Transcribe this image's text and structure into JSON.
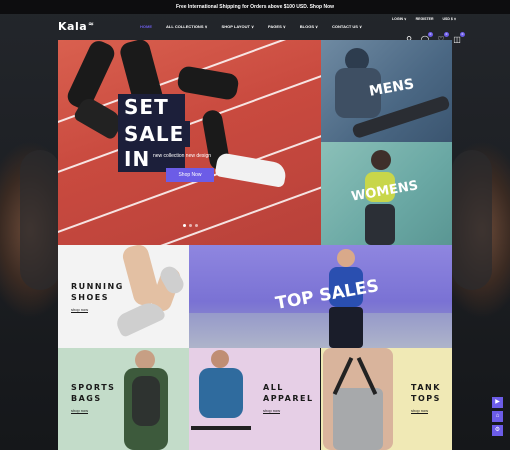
{
  "announcement": "Free International Shipping for Orders above $100 USD. Shop Now",
  "header": {
    "logo": "Kala",
    "nav": [
      "HOME",
      "ALL COLLECTIONS ∨",
      "SHOP LAYOUT ∨",
      "PAGES ∨",
      "BLOGS ∨",
      "CONTACT US ∨"
    ],
    "account": [
      "LOGIN ∨",
      "REGISTER",
      "USD $ ∨"
    ],
    "icons": [
      "search-icon",
      "user-icon",
      "heart-icon",
      "cart-icon"
    ],
    "badges": [
      "0",
      "0",
      "0"
    ]
  },
  "hero": {
    "title_line1": "SET NEW IN",
    "title_line2": "SALE",
    "subtitle": "new collection new design",
    "button": "Shop Now"
  },
  "tiles": {
    "mens": "MENS",
    "womens": "WOMENS",
    "top_sales": "TOP SALES",
    "running_line1": "RUNNING",
    "running_line2": "SHOES",
    "running_link": "shop now",
    "sports_line1": "SPORTS",
    "sports_line2": "BAGS",
    "sports_link": "shop now",
    "apparel_line1": "ALL",
    "apparel_line2": "APPAREL",
    "apparel_link": "shop now",
    "tank_line1": "TANK",
    "tank_line2": "TOPS",
    "tank_link": "shop now"
  },
  "colors": {
    "accent": "#6c5ce7",
    "hero_bg": "#c94a3f",
    "page_bg": "#1b1d21"
  }
}
